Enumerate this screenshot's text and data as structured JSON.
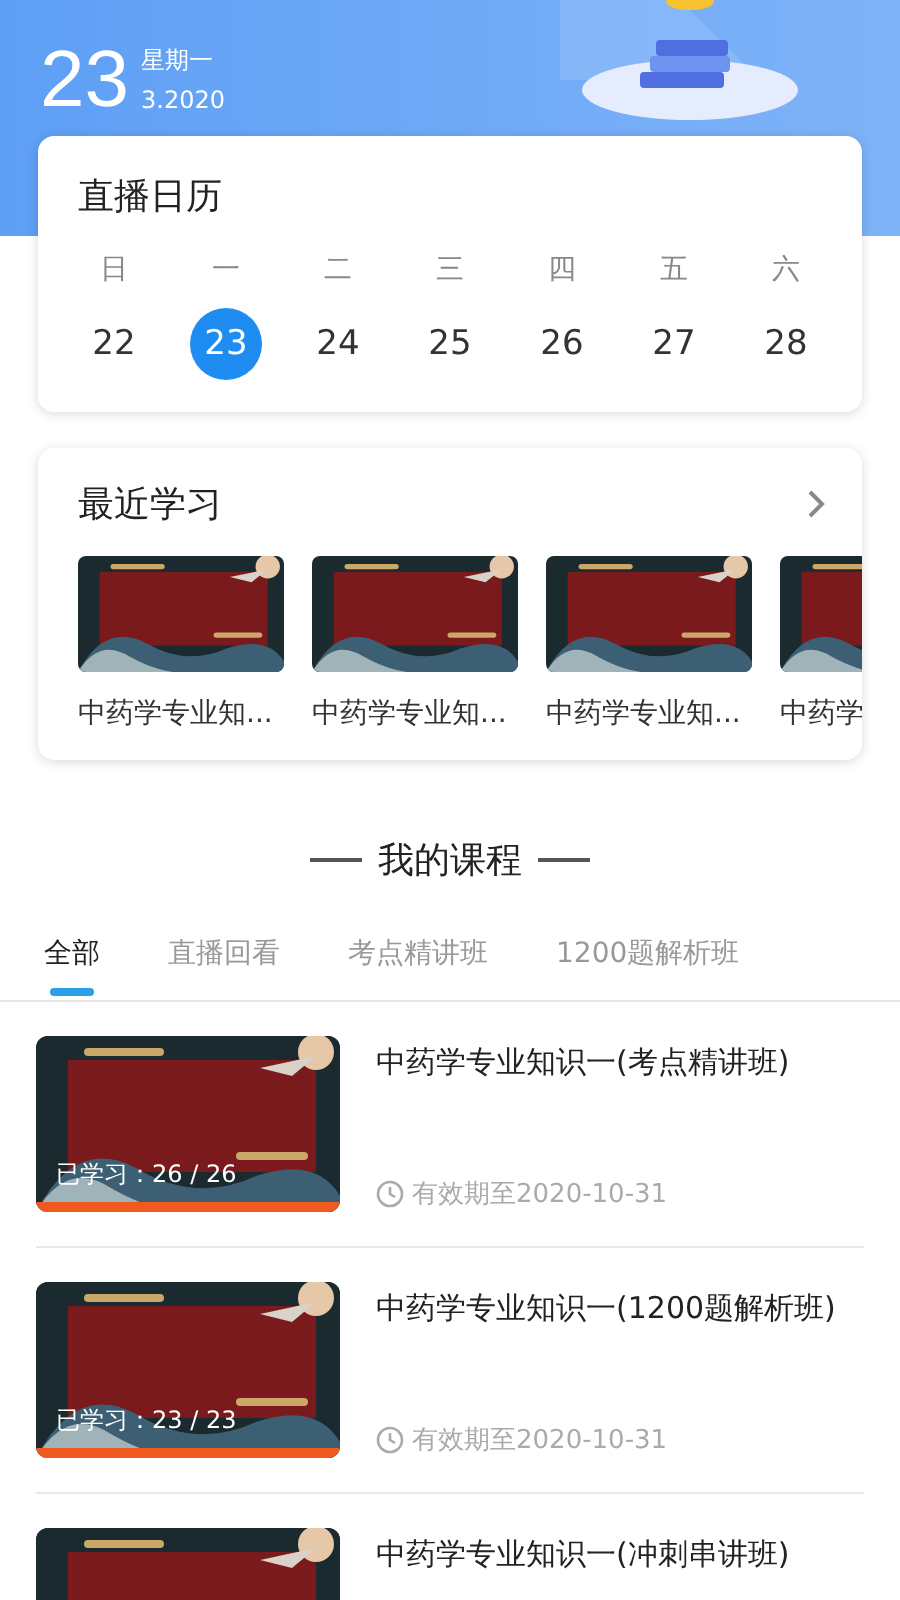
{
  "header": {
    "day": "23",
    "weekday": "星期一",
    "month_year": "3.2020"
  },
  "calendar": {
    "title": "直播日历",
    "days": [
      {
        "weekday": "日",
        "date": "22",
        "selected": false
      },
      {
        "weekday": "一",
        "date": "23",
        "selected": true
      },
      {
        "weekday": "二",
        "date": "24",
        "selected": false
      },
      {
        "weekday": "三",
        "date": "25",
        "selected": false
      },
      {
        "weekday": "四",
        "date": "26",
        "selected": false
      },
      {
        "weekday": "五",
        "date": "27",
        "selected": false
      },
      {
        "weekday": "六",
        "date": "28",
        "selected": false
      }
    ]
  },
  "recent": {
    "title": "最近学习",
    "items": [
      {
        "title": "中药学专业知..."
      },
      {
        "title": "中药学专业知..."
      },
      {
        "title": "中药学专业知..."
      },
      {
        "title": "中药学"
      }
    ]
  },
  "courses_heading": "我的课程",
  "tabs": [
    {
      "label": "全部",
      "selected": true
    },
    {
      "label": "直播回看",
      "selected": false
    },
    {
      "label": "考点精讲班",
      "selected": false
    },
    {
      "label": "1200题解析班",
      "selected": false
    }
  ],
  "courses": [
    {
      "title": "中药学专业知识一(考点精讲班)",
      "progress": "已学习：26 / 26",
      "level": 1,
      "expiry": "有效期至2020-10-31"
    },
    {
      "title": "中药学专业知识一(1200题解析班)",
      "progress": "已学习：23 / 23",
      "level": 1,
      "expiry": "有效期至2020-10-31"
    },
    {
      "title": "中药学专业知识一(冲刺串讲班)"
    }
  ]
}
